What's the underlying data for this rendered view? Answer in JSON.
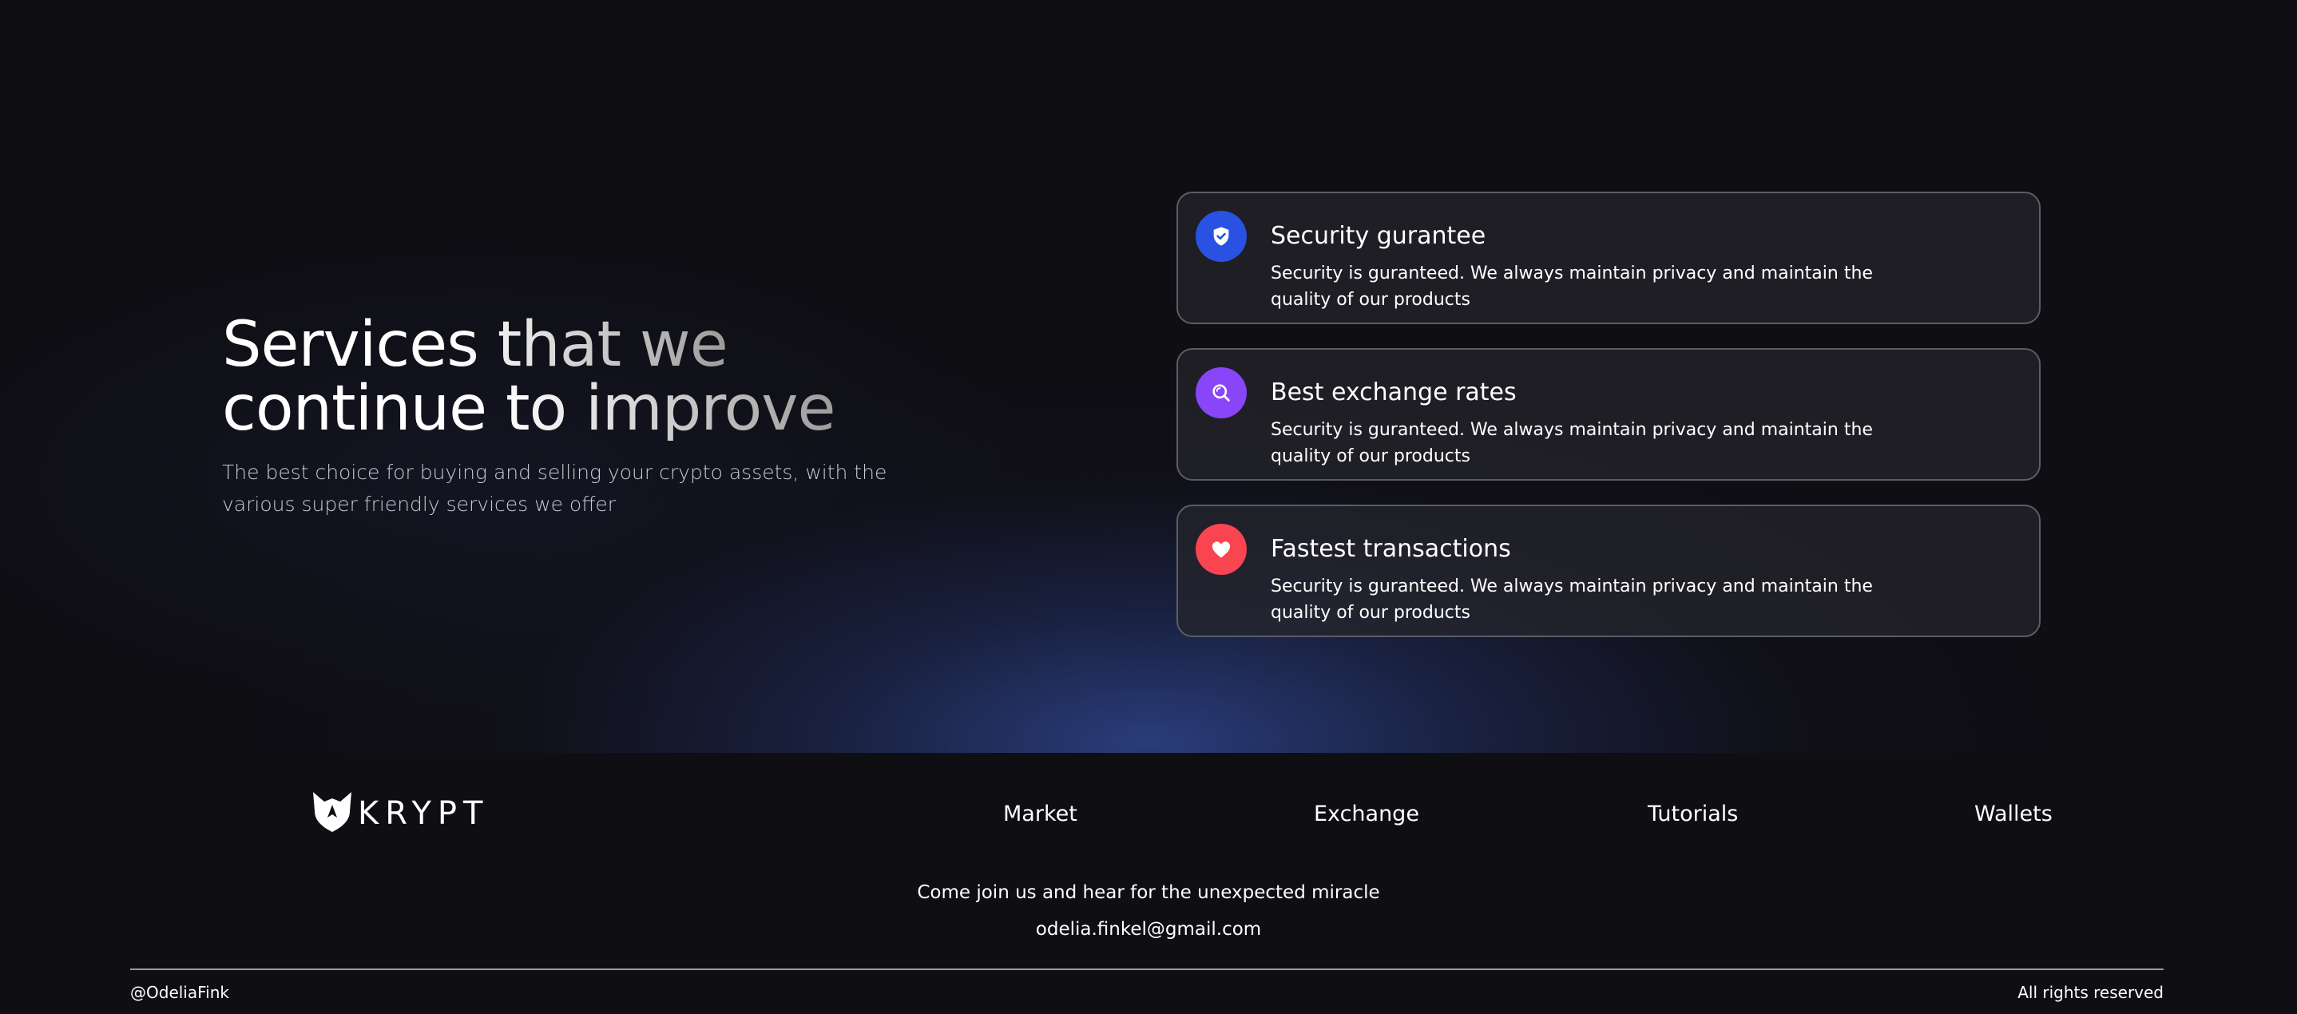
{
  "hero": {
    "title_line1": "Services that we",
    "title_line2": "continue to improve",
    "subtitle": "The best choice for buying and selling your crypto assets, with the various super friendly services we offer"
  },
  "services": [
    {
      "title": "Security gurantee",
      "description": "Security is guranteed. We always maintain privacy and maintain the quality of our products",
      "icon": "shield-check-icon",
      "icon_color": "#2952e3"
    },
    {
      "title": "Best exchange rates",
      "description": "Security is guranteed. We always maintain privacy and maintain the quality of our products",
      "icon": "search-icon",
      "icon_color": "#8945f8"
    },
    {
      "title": "Fastest transactions",
      "description": "Security is guranteed. We always maintain privacy and maintain the quality of our products",
      "icon": "heart-icon",
      "icon_color": "#f84550"
    }
  ],
  "footer": {
    "logo_text": "KRYPT",
    "nav": [
      "Market",
      "Exchange",
      "Tutorials",
      "Wallets"
    ],
    "tagline": "Come join us and hear for the unexpected miracle",
    "email": "odelia.finkel@gmail.com",
    "handle": "@OdeliaFink",
    "rights": "All rights reserved"
  },
  "colors": {
    "background": "#0f0e13",
    "card_border": "#5b5d66",
    "glow_blue": "#2e448c"
  }
}
